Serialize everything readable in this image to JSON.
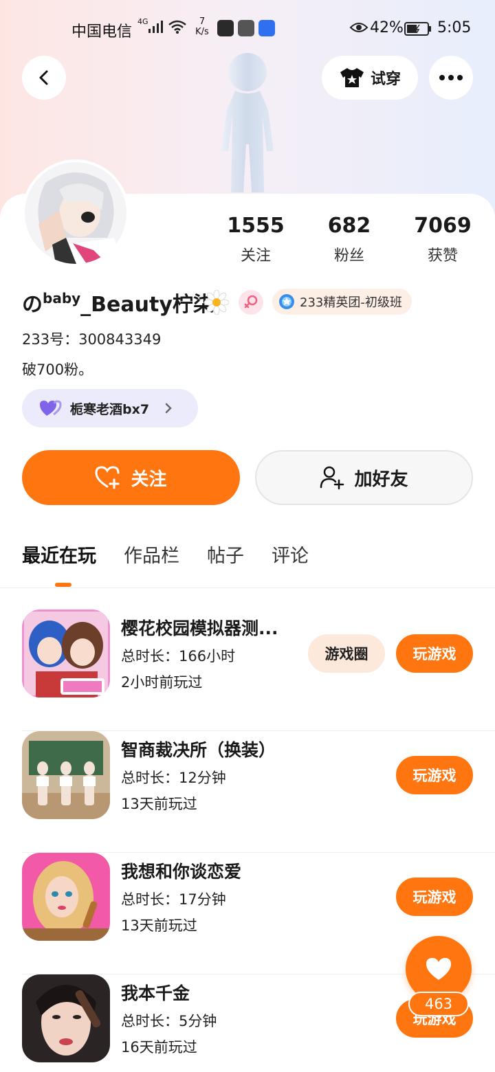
{
  "status_bar": {
    "carrier": "中国电信",
    "network": "4G",
    "speed_value": "7",
    "speed_unit": "K/s",
    "battery_percent": "42%",
    "time": "5:05"
  },
  "header": {
    "tryon_label": "试穿"
  },
  "profile": {
    "stats": [
      {
        "value": "1555",
        "label": "关注"
      },
      {
        "value": "682",
        "label": "粉丝"
      },
      {
        "value": "7069",
        "label": "获赞"
      }
    ],
    "name_prefix": "の",
    "name_sup": "baby",
    "name_suffix": "_Beauty柠柒",
    "level_badge": "233精英团-初级班",
    "uid": "233号：300843349",
    "bio": "破700粉。",
    "cp_name": "栀寒老酒bx7",
    "follow_label": "关注",
    "add_friend_label": "加好友"
  },
  "tabs": [
    "最近在玩",
    "作品栏",
    "帖子",
    "评论"
  ],
  "games": [
    {
      "title": "樱花校园模拟器测...",
      "duration": "总时长：166小时",
      "last_played": "2小时前玩过",
      "circle_label": "游戏圈",
      "play_label": "玩游戏"
    },
    {
      "title": "智商裁决所（换装）",
      "duration": "总时长：12分钟",
      "last_played": "13天前玩过",
      "play_label": "玩游戏"
    },
    {
      "title": "我想和你谈恋爱",
      "duration": "总时长：17分钟",
      "last_played": "13天前玩过",
      "play_label": "玩游戏"
    },
    {
      "title": "我本千金",
      "duration": "总时长：5分钟",
      "last_played": "16天前玩过",
      "play_label": "玩游戏"
    }
  ],
  "like_fab": {
    "count": "463"
  },
  "colors": {
    "accent": "#ff7510",
    "cp_bg": "#ecebfb"
  }
}
